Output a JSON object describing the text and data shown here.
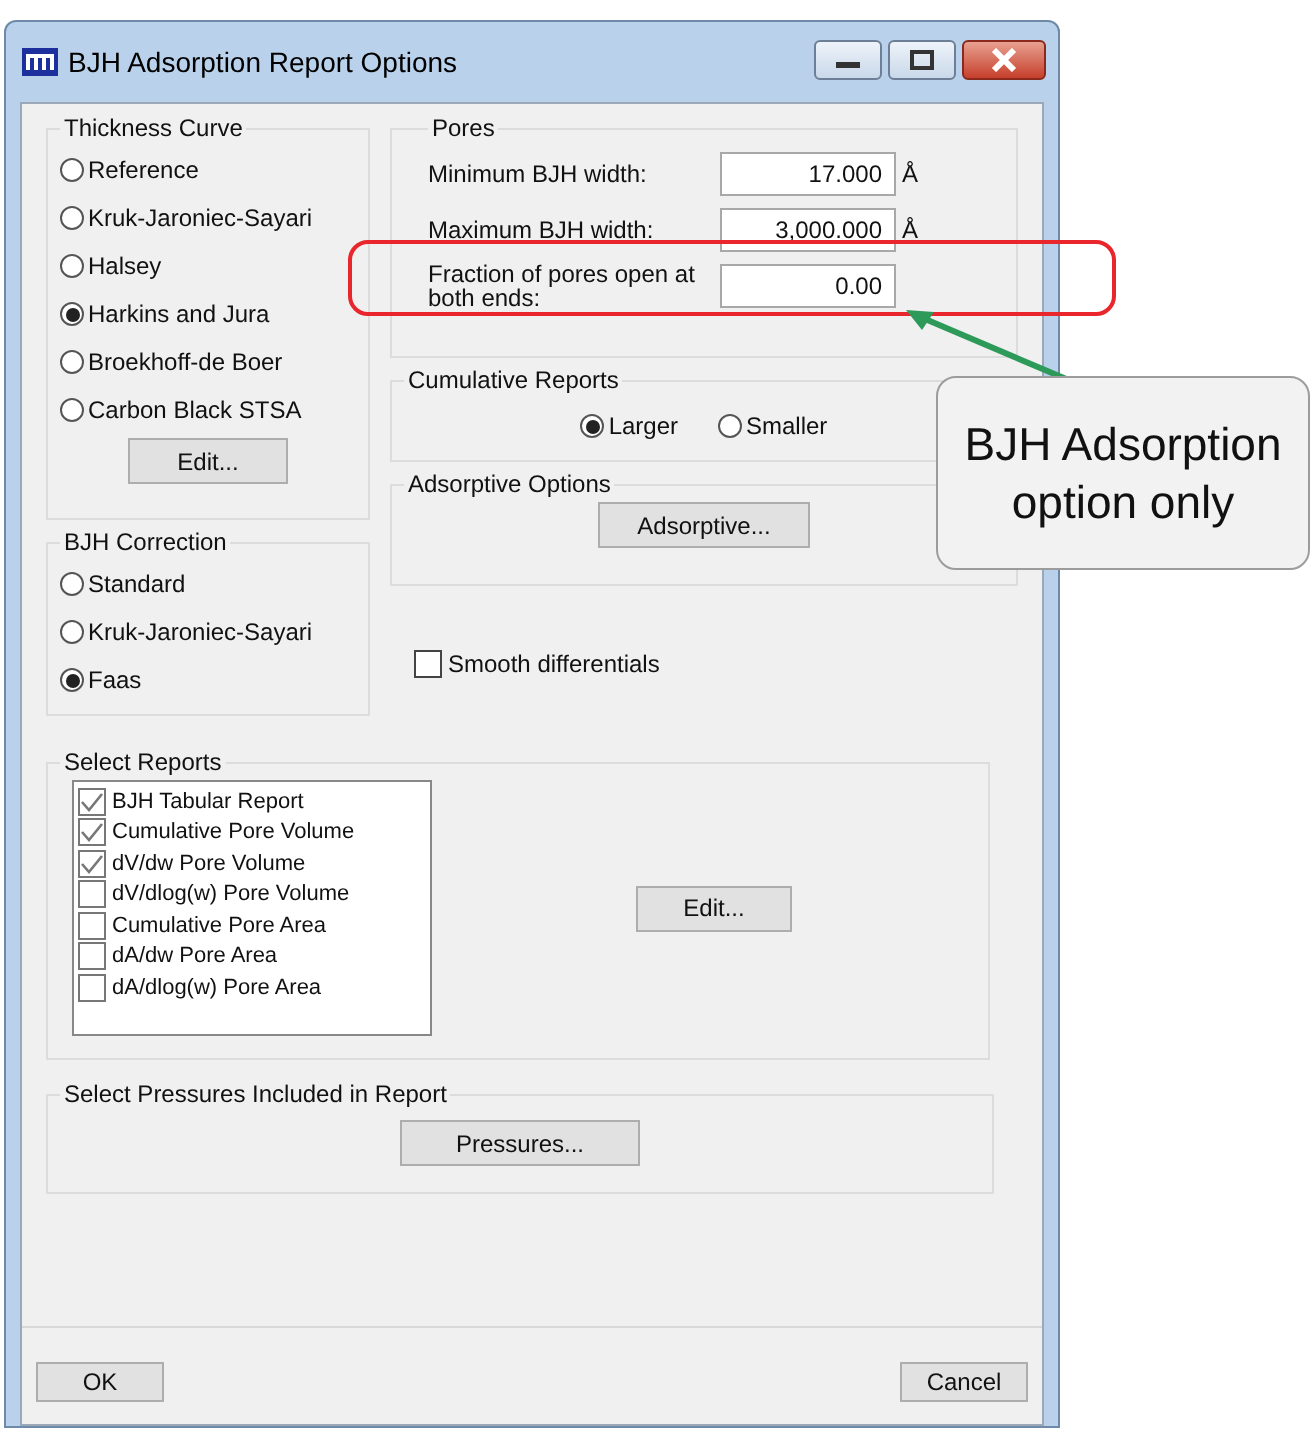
{
  "window": {
    "title": "BJH Adsorption Report Options"
  },
  "thickness_curve": {
    "title": "Thickness Curve",
    "options": [
      {
        "label": "Reference",
        "selected": false
      },
      {
        "label": "Kruk-Jaroniec-Sayari",
        "selected": false
      },
      {
        "label": "Halsey",
        "selected": false
      },
      {
        "label": "Harkins and Jura",
        "selected": true
      },
      {
        "label": "Broekhoff-de Boer",
        "selected": false
      },
      {
        "label": "Carbon Black STSA",
        "selected": false
      }
    ],
    "button": "Edit..."
  },
  "bjh_correction": {
    "title": "BJH Correction",
    "options": [
      {
        "label": "Standard",
        "selected": false
      },
      {
        "label": "Kruk-Jaroniec-Sayari",
        "selected": false
      },
      {
        "label": "Faas",
        "selected": true
      }
    ]
  },
  "pores": {
    "title": "Pores",
    "fields": [
      {
        "label": "Minimum BJH width:",
        "value": "17.000",
        "unit": "Å"
      },
      {
        "label": "Maximum BJH width:",
        "value": "3,000.000",
        "unit": "Å"
      },
      {
        "label": "Fraction of pores open at both ends:",
        "value": "0.00"
      }
    ]
  },
  "cumulative_reports": {
    "title": "Cumulative Reports",
    "options": [
      {
        "label": "Larger",
        "selected": true
      },
      {
        "label": "Smaller",
        "selected": false
      }
    ]
  },
  "adsorptive_options": {
    "title": "Adsorptive Options",
    "button": "Adsorptive..."
  },
  "smooth_differentials": {
    "label": "Smooth differentials",
    "checked": false
  },
  "select_reports": {
    "title": "Select Reports",
    "items": [
      {
        "label": "BJH Tabular Report",
        "checked": true
      },
      {
        "label": "Cumulative Pore Volume",
        "checked": true
      },
      {
        "label": "dV/dw Pore Volume",
        "checked": true
      },
      {
        "label": "dV/dlog(w) Pore Volume",
        "checked": false
      },
      {
        "label": "Cumulative Pore Area",
        "checked": false
      },
      {
        "label": "dA/dw Pore Area",
        "checked": false
      },
      {
        "label": "dA/dlog(w) Pore Area",
        "checked": false
      }
    ],
    "button": "Edit..."
  },
  "select_pressures": {
    "title": "Select Pressures Included in Report",
    "button": "Pressures..."
  },
  "footer_buttons": [
    "OK",
    "Cancel"
  ],
  "annotation": {
    "callout": "BJH Adsorption option only"
  }
}
